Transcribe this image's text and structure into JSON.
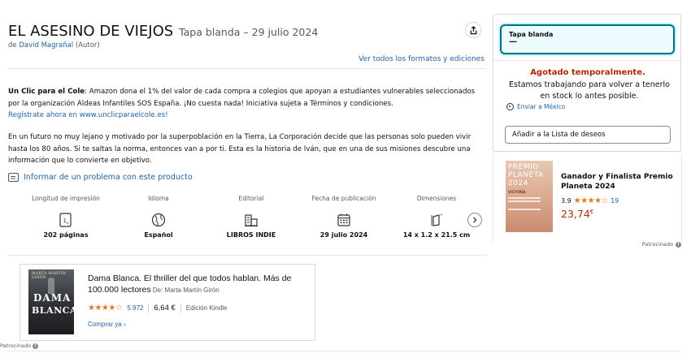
{
  "product": {
    "title": "EL ASESINO DE VIEJOS",
    "format_date": "Tapa blanda – 29 julio 2024",
    "byline_prefix": "de ",
    "author": "David Magrañal",
    "author_role": " (Autor)",
    "all_formats_link": "Ver todos los formatos y ediciones"
  },
  "promo": {
    "bold": "Un Clic para el Cole",
    "text": ": Amazon dona el 1% del valor de cada compra a colegios que apoyan a estudiantes vulnerables seleccionados por la organización Aldeas Infantiles SOS España. ¡No cuesta nada! Iniciativa sujeta a Términos y condiciones.",
    "link": "Regístrate ahora en www.unclicparaelcole.es!"
  },
  "description": "En un futuro no muy lejano y motivado por la superpoblación en la Tierra, La Corporación decide que las personas solo pueden vivir hasta los 80 años. Si te saltas la norma, entonces van a por ti. Esta es la historia de Iván, que en una de sus misiones descubre una información que lo convierte en objetivo.",
  "report_link": "Informar de un problema con este producto",
  "specs": [
    {
      "label": "Longitud de impresión",
      "value": "202 páginas",
      "icon": "pages-icon"
    },
    {
      "label": "Idioma",
      "value": "Español",
      "icon": "globe-icon"
    },
    {
      "label": "Editorial",
      "value": "LIBROS INDIE",
      "icon": "publisher-icon"
    },
    {
      "label": "Fecha de publicación",
      "value": "29 julio 2024",
      "icon": "calendar-icon"
    },
    {
      "label": "Dimensiones",
      "value": "14 x 1.2 x 21.5 cm",
      "icon": "dimensions-icon"
    }
  ],
  "ad": {
    "cover_author": "MARTA MARTÍN GIRÓN",
    "cover_t1": "DAMA",
    "cover_t2": "BLANCA",
    "title": "Dama Blanca. El thriller del que todos hablan. Más de 100.000 lectores",
    "author_prefix": " De: ",
    "author": "Marta Martín Girón",
    "stars": "★★★★☆",
    "rating": 3.5,
    "reviews": "5.972",
    "price": "6,64 €",
    "format": "Edición Kindle",
    "cta": "Comprar ya ›",
    "sponsored": "Patrocinado"
  },
  "buybox": {
    "format_label": "Tapa blanda",
    "format_price": "—",
    "unavailable": "Agotado temporalmente.",
    "unavailable_msg": "Estamos trabajando para volver a tenerlo en stock lo antes posible.",
    "ship_to": "Enviar a México",
    "wishlist": "Añadir a la Lista de deseos"
  },
  "right_ad": {
    "cover_text": "PREMIO PLANETA 2024",
    "cover_author": "VICTORIA",
    "title": "Ganador y Finalista Premio Planeta 2024",
    "rating_value": "3.9",
    "stars": "★★★★☆",
    "rating": 3.9,
    "reviews": "19",
    "price_main": "23,74",
    "price_currency": "€",
    "sponsored": "Patrocinado"
  },
  "colors": {
    "link": "#2162a1",
    "price": "#b12704",
    "star": "#de7921",
    "selected_border": "#007185"
  }
}
